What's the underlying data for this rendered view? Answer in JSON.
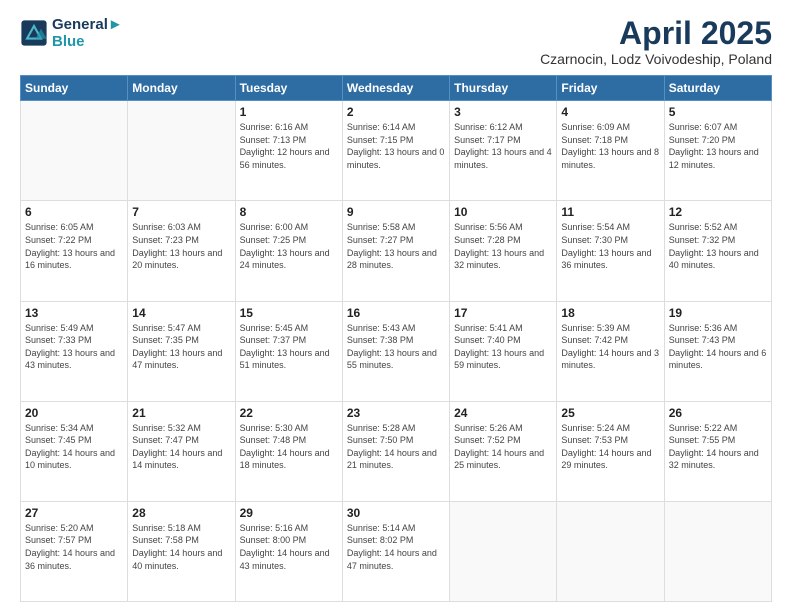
{
  "logo": {
    "line1": "General",
    "line2": "Blue"
  },
  "title": "April 2025",
  "subtitle": "Czarnocin, Lodz Voivodeship, Poland",
  "weekdays": [
    "Sunday",
    "Monday",
    "Tuesday",
    "Wednesday",
    "Thursday",
    "Friday",
    "Saturday"
  ],
  "weeks": [
    [
      {
        "date": "",
        "info": ""
      },
      {
        "date": "",
        "info": ""
      },
      {
        "date": "1",
        "info": "Sunrise: 6:16 AM\nSunset: 7:13 PM\nDaylight: 12 hours and 56 minutes."
      },
      {
        "date": "2",
        "info": "Sunrise: 6:14 AM\nSunset: 7:15 PM\nDaylight: 13 hours and 0 minutes."
      },
      {
        "date": "3",
        "info": "Sunrise: 6:12 AM\nSunset: 7:17 PM\nDaylight: 13 hours and 4 minutes."
      },
      {
        "date": "4",
        "info": "Sunrise: 6:09 AM\nSunset: 7:18 PM\nDaylight: 13 hours and 8 minutes."
      },
      {
        "date": "5",
        "info": "Sunrise: 6:07 AM\nSunset: 7:20 PM\nDaylight: 13 hours and 12 minutes."
      }
    ],
    [
      {
        "date": "6",
        "info": "Sunrise: 6:05 AM\nSunset: 7:22 PM\nDaylight: 13 hours and 16 minutes."
      },
      {
        "date": "7",
        "info": "Sunrise: 6:03 AM\nSunset: 7:23 PM\nDaylight: 13 hours and 20 minutes."
      },
      {
        "date": "8",
        "info": "Sunrise: 6:00 AM\nSunset: 7:25 PM\nDaylight: 13 hours and 24 minutes."
      },
      {
        "date": "9",
        "info": "Sunrise: 5:58 AM\nSunset: 7:27 PM\nDaylight: 13 hours and 28 minutes."
      },
      {
        "date": "10",
        "info": "Sunrise: 5:56 AM\nSunset: 7:28 PM\nDaylight: 13 hours and 32 minutes."
      },
      {
        "date": "11",
        "info": "Sunrise: 5:54 AM\nSunset: 7:30 PM\nDaylight: 13 hours and 36 minutes."
      },
      {
        "date": "12",
        "info": "Sunrise: 5:52 AM\nSunset: 7:32 PM\nDaylight: 13 hours and 40 minutes."
      }
    ],
    [
      {
        "date": "13",
        "info": "Sunrise: 5:49 AM\nSunset: 7:33 PM\nDaylight: 13 hours and 43 minutes."
      },
      {
        "date": "14",
        "info": "Sunrise: 5:47 AM\nSunset: 7:35 PM\nDaylight: 13 hours and 47 minutes."
      },
      {
        "date": "15",
        "info": "Sunrise: 5:45 AM\nSunset: 7:37 PM\nDaylight: 13 hours and 51 minutes."
      },
      {
        "date": "16",
        "info": "Sunrise: 5:43 AM\nSunset: 7:38 PM\nDaylight: 13 hours and 55 minutes."
      },
      {
        "date": "17",
        "info": "Sunrise: 5:41 AM\nSunset: 7:40 PM\nDaylight: 13 hours and 59 minutes."
      },
      {
        "date": "18",
        "info": "Sunrise: 5:39 AM\nSunset: 7:42 PM\nDaylight: 14 hours and 3 minutes."
      },
      {
        "date": "19",
        "info": "Sunrise: 5:36 AM\nSunset: 7:43 PM\nDaylight: 14 hours and 6 minutes."
      }
    ],
    [
      {
        "date": "20",
        "info": "Sunrise: 5:34 AM\nSunset: 7:45 PM\nDaylight: 14 hours and 10 minutes."
      },
      {
        "date": "21",
        "info": "Sunrise: 5:32 AM\nSunset: 7:47 PM\nDaylight: 14 hours and 14 minutes."
      },
      {
        "date": "22",
        "info": "Sunrise: 5:30 AM\nSunset: 7:48 PM\nDaylight: 14 hours and 18 minutes."
      },
      {
        "date": "23",
        "info": "Sunrise: 5:28 AM\nSunset: 7:50 PM\nDaylight: 14 hours and 21 minutes."
      },
      {
        "date": "24",
        "info": "Sunrise: 5:26 AM\nSunset: 7:52 PM\nDaylight: 14 hours and 25 minutes."
      },
      {
        "date": "25",
        "info": "Sunrise: 5:24 AM\nSunset: 7:53 PM\nDaylight: 14 hours and 29 minutes."
      },
      {
        "date": "26",
        "info": "Sunrise: 5:22 AM\nSunset: 7:55 PM\nDaylight: 14 hours and 32 minutes."
      }
    ],
    [
      {
        "date": "27",
        "info": "Sunrise: 5:20 AM\nSunset: 7:57 PM\nDaylight: 14 hours and 36 minutes."
      },
      {
        "date": "28",
        "info": "Sunrise: 5:18 AM\nSunset: 7:58 PM\nDaylight: 14 hours and 40 minutes."
      },
      {
        "date": "29",
        "info": "Sunrise: 5:16 AM\nSunset: 8:00 PM\nDaylight: 14 hours and 43 minutes."
      },
      {
        "date": "30",
        "info": "Sunrise: 5:14 AM\nSunset: 8:02 PM\nDaylight: 14 hours and 47 minutes."
      },
      {
        "date": "",
        "info": ""
      },
      {
        "date": "",
        "info": ""
      },
      {
        "date": "",
        "info": ""
      }
    ]
  ]
}
